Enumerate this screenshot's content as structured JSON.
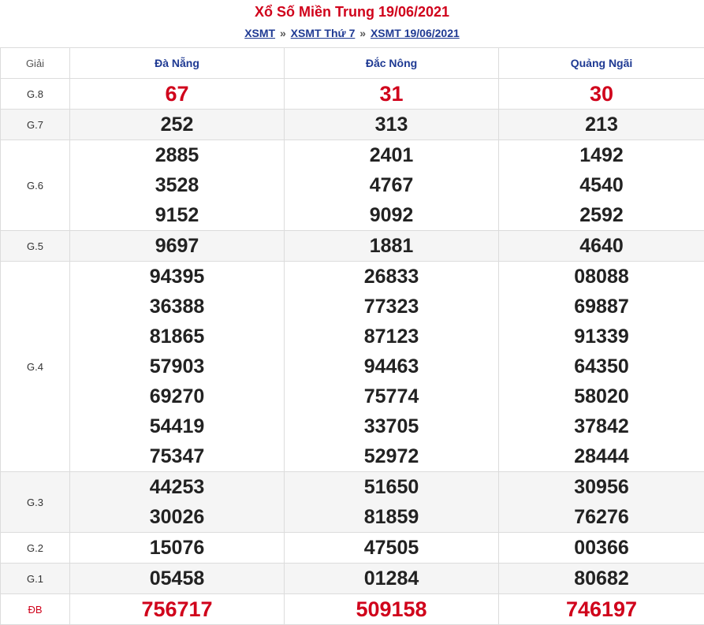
{
  "header": {
    "title": "Xổ Số Miền Trung 19/06/2021",
    "breadcrumb": [
      "XSMT",
      "XSMT Thứ 7",
      "XSMT 19/06/2021"
    ],
    "separator": "»"
  },
  "table": {
    "col_header": "Giải",
    "provinces": [
      "Đà Nẵng",
      "Đắc Nông",
      "Quảng Ngãi"
    ],
    "rows": [
      {
        "label": "G.8",
        "values": [
          [
            "67"
          ],
          [
            "31"
          ],
          [
            "30"
          ]
        ]
      },
      {
        "label": "G.7",
        "values": [
          [
            "252"
          ],
          [
            "313"
          ],
          [
            "213"
          ]
        ]
      },
      {
        "label": "G.6",
        "values": [
          [
            "2885",
            "3528",
            "9152"
          ],
          [
            "2401",
            "4767",
            "9092"
          ],
          [
            "1492",
            "4540",
            "2592"
          ]
        ]
      },
      {
        "label": "G.5",
        "values": [
          [
            "9697"
          ],
          [
            "1881"
          ],
          [
            "4640"
          ]
        ]
      },
      {
        "label": "G.4",
        "values": [
          [
            "94395",
            "36388",
            "81865",
            "57903",
            "69270",
            "54419",
            "75347"
          ],
          [
            "26833",
            "77323",
            "87123",
            "94463",
            "75774",
            "33705",
            "52972"
          ],
          [
            "08088",
            "69887",
            "91339",
            "64350",
            "58020",
            "37842",
            "28444"
          ]
        ]
      },
      {
        "label": "G.3",
        "values": [
          [
            "44253",
            "30026"
          ],
          [
            "51650",
            "81859"
          ],
          [
            "30956",
            "76276"
          ]
        ]
      },
      {
        "label": "G.2",
        "values": [
          [
            "15076"
          ],
          [
            "47505"
          ],
          [
            "00366"
          ]
        ]
      },
      {
        "label": "G.1",
        "values": [
          [
            "05458"
          ],
          [
            "01284"
          ],
          [
            "80682"
          ]
        ]
      },
      {
        "label": "ĐB",
        "values": [
          [
            "756717"
          ],
          [
            "509158"
          ],
          [
            "746197"
          ]
        ]
      }
    ]
  },
  "colors": {
    "accent_red": "#d0021b",
    "link_blue": "#1f3a93",
    "alt_row": "#f5f5f5"
  }
}
